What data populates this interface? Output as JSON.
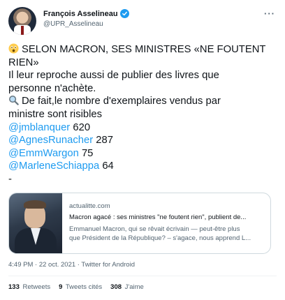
{
  "author": {
    "display_name": "François Asselineau",
    "handle": "@UPR_Asselineau",
    "verified": true
  },
  "tweet": {
    "line1": "SELON MACRON, SES MINISTRES «NE FOUTENT",
    "line2": "RIEN»",
    "line3": "Il leur reproche aussi de publier des livres que",
    "line4": "personne n'achète.",
    "line5": "De fait,le nombre d'exemplaires vendus par",
    "line6": "ministre sont risibles",
    "mentions": [
      {
        "handle": "@jmblanquer",
        "count": "620"
      },
      {
        "handle": "@AgnesRunacher",
        "count": "287"
      },
      {
        "handle": "@EmmWargon",
        "count": "75"
      },
      {
        "handle": "@MarleneSchiappa",
        "count": "64"
      }
    ],
    "trailing": "-",
    "emoji_first": "astonished-face-icon",
    "emoji_second": "magnifying-glass-icon"
  },
  "card": {
    "domain": "actualitte.com",
    "title": "Macron agacé : ses ministres \"ne foutent rien\", publient de...",
    "desc_line1": "Emmanuel Macron, qui se rêvait écrivain — peut-être plus",
    "desc_line2": "que Président de la République? – s'agace, nous apprend L..."
  },
  "meta": {
    "time": "4:49 PM",
    "separator": "·",
    "date": "22 oct. 2021",
    "source": "Twitter for Android"
  },
  "stats": {
    "retweets_count": "133",
    "retweets_label": "Retweets",
    "quotes_count": "9",
    "quotes_label": "Tweets cités",
    "likes_count": "308",
    "likes_label": "J'aime"
  },
  "colors": {
    "link": "#1d9bf0",
    "text": "#0f1419",
    "muted": "#536471",
    "border": "#cfd9de"
  }
}
